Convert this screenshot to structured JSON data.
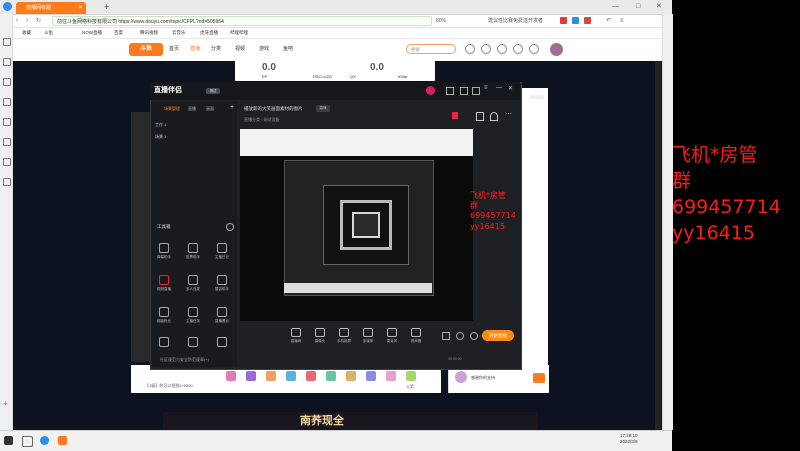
{
  "browser": {
    "tab_title": "直播间标题",
    "new_tab": "+",
    "window_controls": [
      "—",
      "□",
      "✕"
    ],
    "address": "前往斗鱼网络科技有限公司 https://www.douyu.com/topic/CFPL?rid=505964",
    "zoom": "80%",
    "search_box": "建议性比赛免费送开发者",
    "bookmarks": [
      "收藏",
      "斗鱼",
      "NOW直播",
      "百度",
      "腾讯视频",
      "云音乐",
      "虎牙直播",
      "哔哩哔哩"
    ]
  },
  "douyu": {
    "logo": "斗鱼",
    "nav": [
      "首页",
      "直播",
      "分类",
      "视频",
      "游戏",
      "鱼吧"
    ],
    "search_placeholder": "搜索",
    "team_scores": [
      "0.0",
      "0.0"
    ],
    "teams": [
      "EP",
      "RSCLUZD",
      "QX",
      "eStar"
    ],
    "gift_label": "火箭",
    "gift_text": "【1级】你可以领到6+8500",
    "banner_text": "南荞现全",
    "chat_line": "感谢你的支持"
  },
  "app": {
    "logo": "直播伴侣",
    "badge": "测试",
    "tabs": [
      "场景管理",
      "直播",
      "画面"
    ],
    "scenes": [
      "场景 1",
      "工作 1"
    ],
    "live_title": "播放新的大笑画面素材的图片",
    "tag": "游戏",
    "sub_info": "直播分类 · 测试设备",
    "tools_title": "工具箱",
    "tools": [
      "弹幕助手",
      "投票助手",
      "主播日记",
      "视频直播",
      "多人连麦",
      "整容助手",
      "超级粉丝",
      "主播任务",
      "直播看点",
      "抽奖助手",
      "直播答题",
      "连麦PK"
    ],
    "tip": "社区规范与安全防范规章(+)",
    "controls": [
      "直播间",
      "摄像头",
      "手机投屏",
      "多媒体",
      "麦克风",
      "扬声器"
    ],
    "start_button": "开始直播",
    "status": "00:00:00"
  },
  "overlay": {
    "line1": "飞机*房管",
    "line2": "群",
    "line3": "699457714",
    "line4": "yy16415"
  },
  "taskbar": {
    "time": "17:28:10",
    "date": "2022/3/9"
  },
  "colors": {
    "accent": "#ff7a1a",
    "overlay_red": "#ff1a1a"
  }
}
